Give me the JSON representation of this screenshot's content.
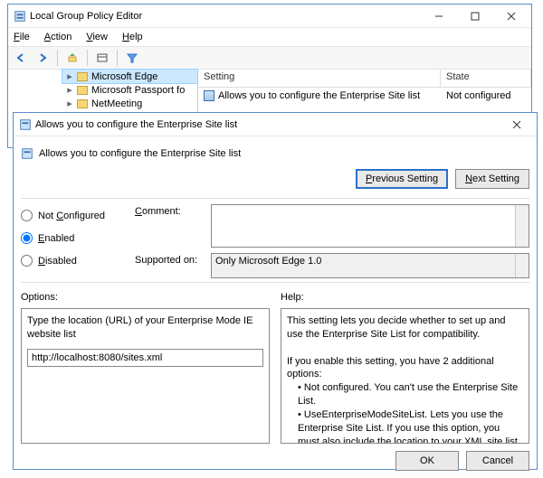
{
  "gp": {
    "title": "Local Group Policy Editor",
    "menu": {
      "file": "File",
      "action": "Action",
      "view": "View",
      "help": "Help"
    },
    "tree": {
      "item1": "Microsoft Edge",
      "item2": "Microsoft Passport fo",
      "item3": "NetMeeting"
    },
    "columns": {
      "setting": "Setting",
      "state": "State"
    },
    "row": {
      "name": "Allows you to configure the Enterprise Site list",
      "state": "Not configured"
    }
  },
  "dlg": {
    "title": "Allows you to configure the Enterprise Site list",
    "heading": "Allows you to configure the Enterprise Site list",
    "prev": "Previous Setting",
    "next": "Next Setting",
    "state_notconfigured": "Not Configured",
    "state_enabled": "Enabled",
    "state_disabled": "Disabled",
    "comment_label": "Comment:",
    "supported_label": "Supported on:",
    "supported_value": "Only Microsoft Edge 1.0",
    "options_label": "Options:",
    "help_label": "Help:",
    "option_prompt": "Type the location (URL) of your Enterprise Mode IE website list",
    "url_value": "http://localhost:8080/sites.xml",
    "help_p1": "This setting lets you decide whether to set up and use the Enterprise Site List for compatibility.",
    "help_p2": "If you enable this setting, you have 2 additional options:",
    "help_b1": "Not configured. You can't use the Enterprise Site List.",
    "help_b2": "UseEnterpriseModeSiteList. Lets you use the Enterprise Site List. If you use this option, you must also include the location to your XML site list in the {URI} box. This is the default value.",
    "ok": "OK",
    "cancel": "Cancel"
  }
}
